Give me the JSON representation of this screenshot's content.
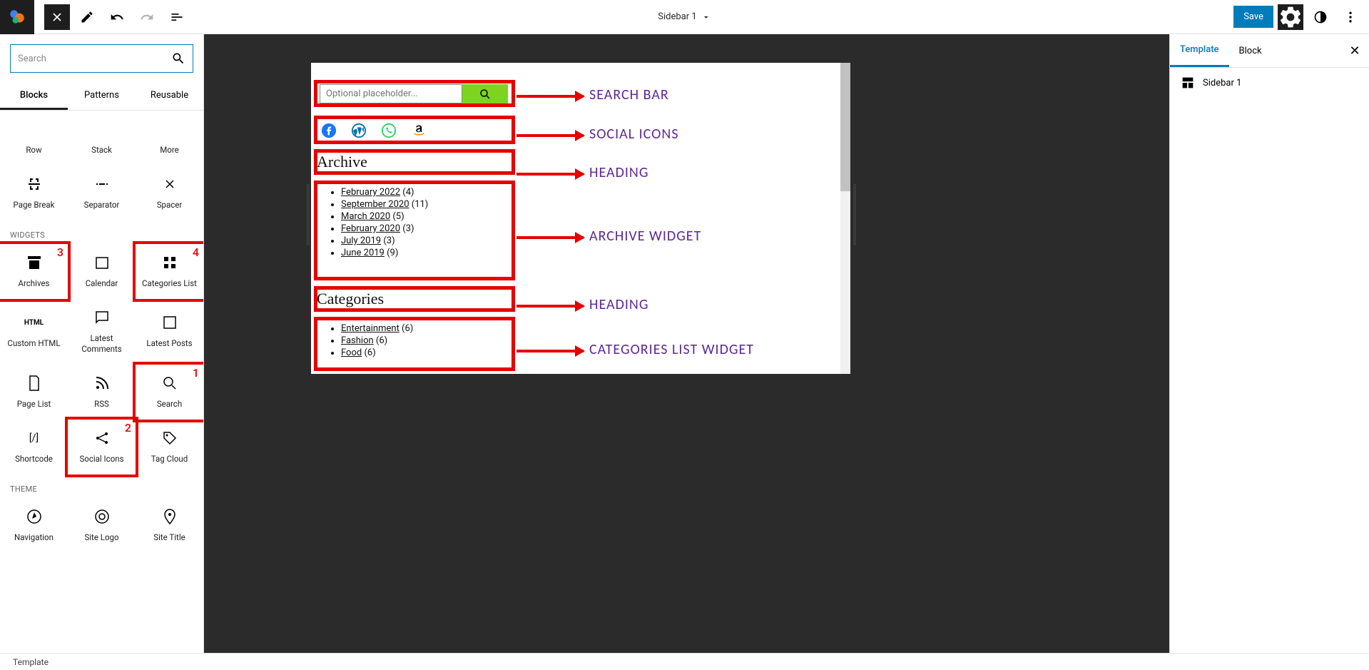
{
  "topbar": {
    "title": "Sidebar 1",
    "save_label": "Save"
  },
  "inserter": {
    "search_placeholder": "Search",
    "tabs": [
      "Blocks",
      "Patterns",
      "Reusable"
    ],
    "row1": [
      "Row",
      "Stack",
      "More"
    ],
    "row2": [
      "Page Break",
      "Separator",
      "Spacer"
    ],
    "section_widgets": "WIDGETS",
    "widgets": [
      "Archives",
      "Calendar",
      "Categories List",
      "Custom HTML",
      "Latest Comments",
      "Latest Posts",
      "Page List",
      "RSS",
      "Search",
      "Shortcode",
      "Social Icons",
      "Tag Cloud"
    ],
    "section_theme": "THEME",
    "theme": [
      "Navigation",
      "Site Logo",
      "Site Title"
    ]
  },
  "preview": {
    "search_placeholder": "Optional placeholder...",
    "heading_archive": "Archive",
    "heading_categories": "Categories",
    "archives": [
      {
        "label": "February 2022",
        "count": "(4)"
      },
      {
        "label": "September 2020",
        "count": "(11)"
      },
      {
        "label": "March 2020",
        "count": "(5)"
      },
      {
        "label": "February 2020",
        "count": "(3)"
      },
      {
        "label": "July 2019",
        "count": "(3)"
      },
      {
        "label": "June 2019",
        "count": "(9)"
      }
    ],
    "categories": [
      {
        "label": "Entertainment",
        "count": "(6)"
      },
      {
        "label": "Fashion",
        "count": "(6)"
      },
      {
        "label": "Food",
        "count": "(6)"
      }
    ]
  },
  "annotations": {
    "a1": "SEARCH BAR",
    "a2": "SOCIAL ICONS",
    "a3": "HEADING",
    "a4": "ARCHIVE WIDGET",
    "a5": "HEADING",
    "a6": "CATEGORIES LIST WIDGET",
    "n1": "1",
    "n2": "2",
    "n3": "3",
    "n4": "4"
  },
  "settings": {
    "tabs": [
      "Template",
      "Block"
    ],
    "template_name": "Sidebar 1"
  },
  "footer": {
    "breadcrumb": "Template"
  }
}
